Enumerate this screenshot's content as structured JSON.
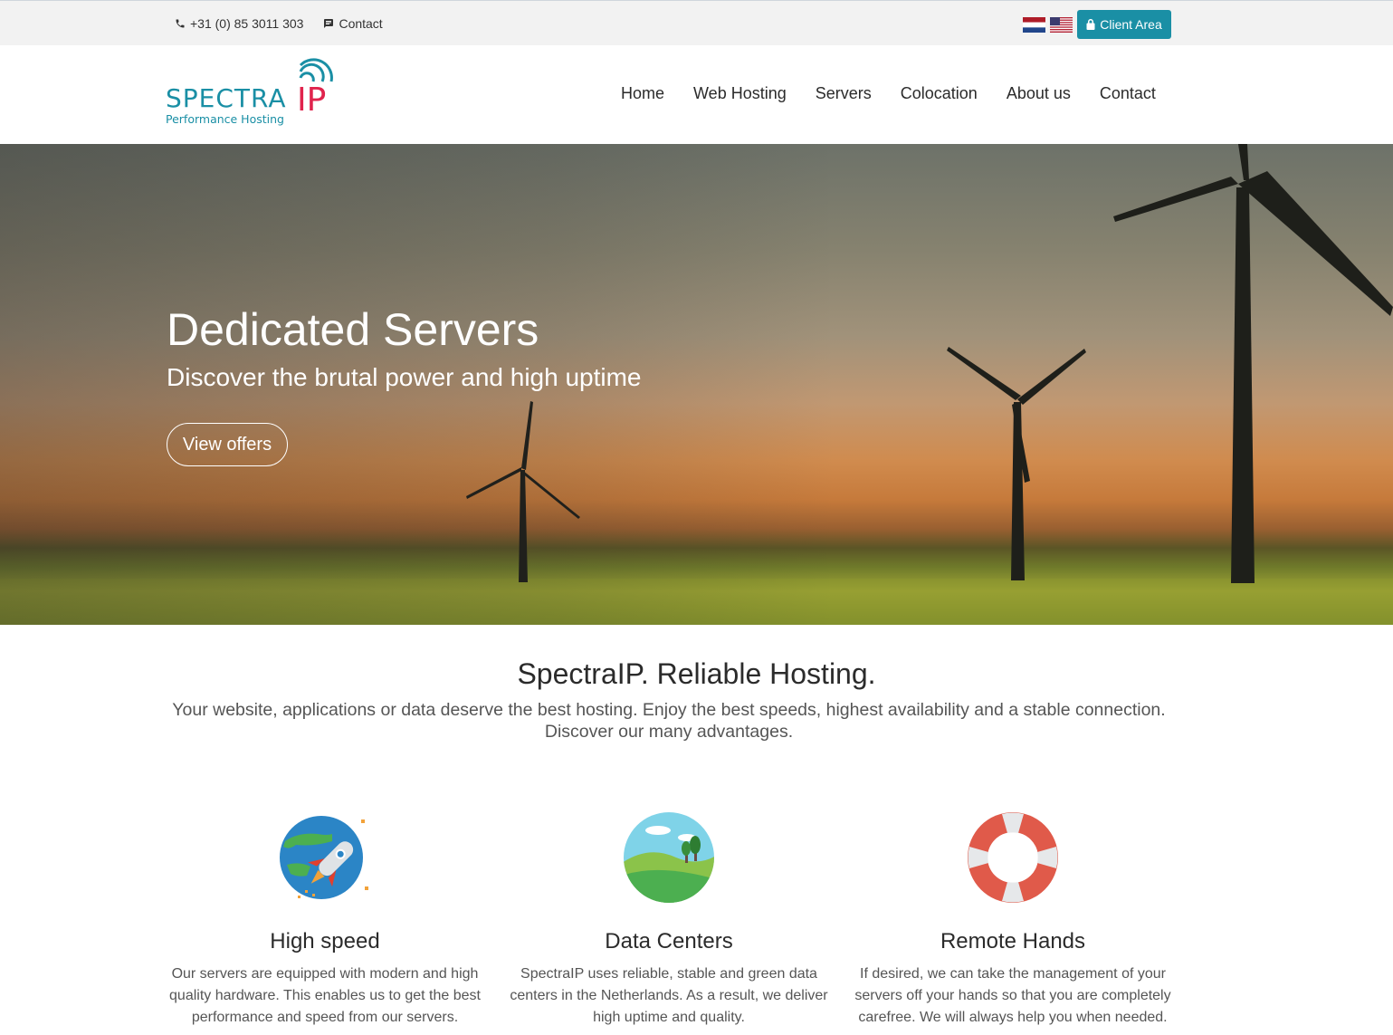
{
  "topbar": {
    "phone": "+31 (0) 85 3011 303",
    "contact": "Contact",
    "flags": [
      "flag-nl",
      "flag-us"
    ],
    "client_area": "Client Area"
  },
  "logo": {
    "name": "SPECTRA",
    "suffix": "IP",
    "tagline": "Performance Hosting"
  },
  "nav": {
    "items": [
      "Home",
      "Web Hosting",
      "Servers",
      "Colocation",
      "About us",
      "Contact"
    ]
  },
  "hero": {
    "title": "Dedicated Servers",
    "subtitle": "Discover the brutal power and high uptime",
    "button": "View offers"
  },
  "intro": {
    "title": "SpectraIP. Reliable Hosting.",
    "text": "Your website, applications or data deserve the best hosting. Enjoy the best speeds, highest availability and a stable connection. Discover our many advantages."
  },
  "features": [
    {
      "icon": "rocket-globe-icon",
      "title": "High speed",
      "text": "Our servers are equipped with modern and high quality hardware. This enables us to get the best performance and speed from our servers."
    },
    {
      "icon": "landscape-icon",
      "title": "Data Centers",
      "text": "SpectraIP uses reliable, stable and green data centers in the Netherlands. As a result, we deliver high uptime and quality."
    },
    {
      "icon": "lifebuoy-icon",
      "title": "Remote Hands",
      "text": "If desired, we can take the management of your servers off your hands so that you are completely carefree. We will always help you when needed."
    }
  ],
  "colors": {
    "accent": "#1a8fa5",
    "brand_teal": "#1a8fa5",
    "brand_red": "#e0244d"
  }
}
